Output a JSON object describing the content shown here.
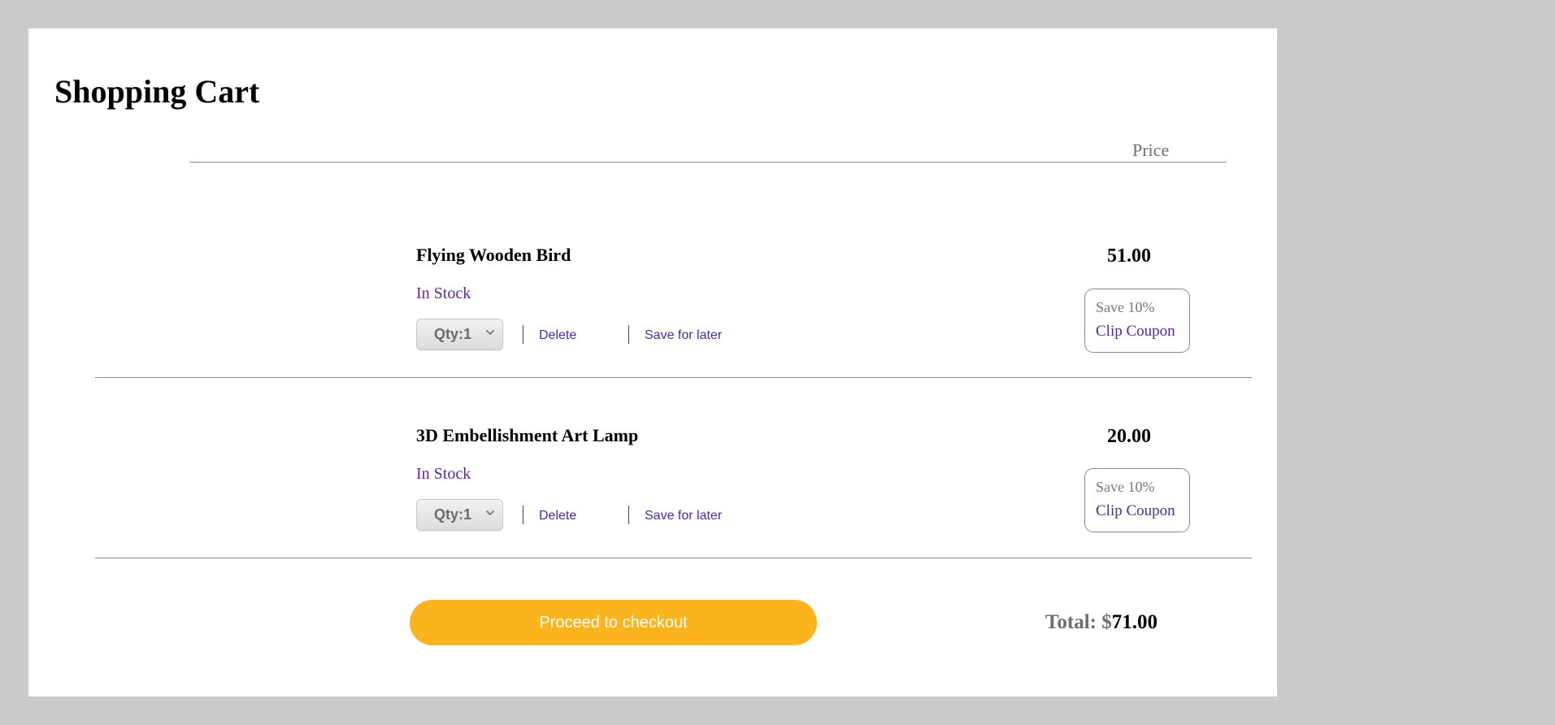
{
  "page": {
    "title": "Shopping Cart",
    "price_header": "Price"
  },
  "items": [
    {
      "name": "Flying Wooden Bird",
      "stock": "In Stock",
      "qty_label": "Qty:1",
      "delete_label": "Delete",
      "save_label": "Save for later",
      "price": "51.00",
      "coupon_save": "Save 10%",
      "coupon_clip": "Clip Coupon"
    },
    {
      "name": "3D Embellishment Art Lamp",
      "stock": "In Stock",
      "qty_label": "Qty:1",
      "delete_label": "Delete",
      "save_label": "Save for later",
      "price": "20.00",
      "coupon_save": "Save 10%",
      "coupon_clip": "Clip Coupon"
    }
  ],
  "footer": {
    "checkout_label": "Proceed to checkout",
    "total_label": "Total: $",
    "total_value": "71.00"
  },
  "colors": {
    "background": "#cacaca",
    "panel": "#ffffff",
    "link": "#4b2aa0",
    "checkout_button": "#fbb41e",
    "muted_text": "#6e6e6e"
  },
  "icons": {
    "qty_dropdown": "chevron-down-icon"
  }
}
